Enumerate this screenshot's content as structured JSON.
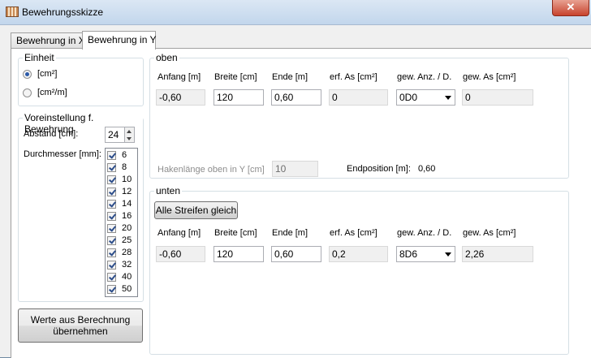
{
  "window": {
    "title": "Bewehrungsskizze",
    "close_symbol": "✕"
  },
  "tabs": [
    {
      "label": "Bewehrung in X"
    },
    {
      "label": "Bewehrung in Y"
    }
  ],
  "einheit": {
    "title": "Einheit",
    "options": [
      {
        "label": "[cm²]",
        "selected": true
      },
      {
        "label": "[cm²/m]",
        "selected": false
      }
    ]
  },
  "voreinstellung": {
    "title": "Voreinstellung f. Bewehrung",
    "abstand_label": "Abstand [cm]:",
    "abstand_value": "24",
    "durchmesser_label": "Durchmesser [mm]:",
    "durchmesser": [
      {
        "value": "6",
        "checked": true
      },
      {
        "value": "8",
        "checked": true
      },
      {
        "value": "10",
        "checked": true
      },
      {
        "value": "12",
        "checked": true
      },
      {
        "value": "14",
        "checked": true
      },
      {
        "value": "16",
        "checked": true
      },
      {
        "value": "20",
        "checked": true
      },
      {
        "value": "25",
        "checked": true
      },
      {
        "value": "28",
        "checked": true
      },
      {
        "value": "32",
        "checked": true
      },
      {
        "value": "40",
        "checked": true
      },
      {
        "value": "50",
        "checked": true
      }
    ]
  },
  "werte_button": {
    "line1": "Werte aus Berechnung",
    "line2": "übernehmen"
  },
  "columns": {
    "anfang": "Anfang [m]",
    "breite": "Breite [cm]",
    "ende": "Ende [m]",
    "erf_as": "erf. As   [cm²]",
    "gew_anz": "gew. Anz. / D.",
    "gew_as": "gew. As   [cm²]"
  },
  "oben": {
    "title": "oben",
    "anfang": "-0,60",
    "breite": "120",
    "ende": "0,60",
    "erf_as": "0",
    "gew_anz": "0D0",
    "gew_as": "0",
    "hakenlaenge_label": "Hakenlänge oben in Y [cm]",
    "hakenlaenge_value": "10",
    "endposition_label": "Endposition [m]:",
    "endposition_value": "0,60"
  },
  "unten": {
    "title": "unten",
    "alle_button": "Alle Streifen gleich",
    "anfang": "-0,60",
    "breite": "120",
    "ende": "0,60",
    "erf_as": "0,2",
    "gew_anz": "8D6",
    "gew_as": "2,26"
  }
}
